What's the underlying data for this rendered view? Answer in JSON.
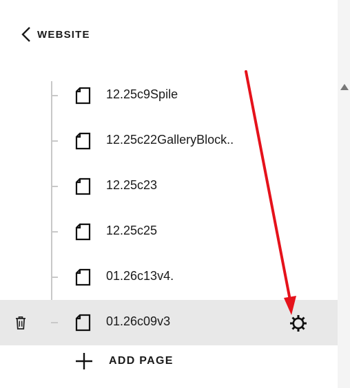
{
  "header": {
    "back_label": "WEBSITE"
  },
  "pages": [
    {
      "name": "12.25c9Spile",
      "selected": false
    },
    {
      "name": "12.25c22GalleryBlock..",
      "selected": false
    },
    {
      "name": "12.25c23",
      "selected": false
    },
    {
      "name": "12.25c25",
      "selected": false
    },
    {
      "name": "01.26c13v4.",
      "selected": false
    },
    {
      "name": "01.26c09v3",
      "selected": true
    }
  ],
  "footer": {
    "add_page_label": "ADD PAGE"
  },
  "icons": {
    "back": "chevron-left-icon",
    "page": "page-icon",
    "trash": "trash-icon",
    "gear": "gear-icon",
    "add": "plus-icon",
    "annotation": "red-arrow"
  },
  "colors": {
    "selected_row": "#e8e8e8",
    "annotation_arrow": "#e5121b",
    "tree_line": "#c8c8c8"
  }
}
